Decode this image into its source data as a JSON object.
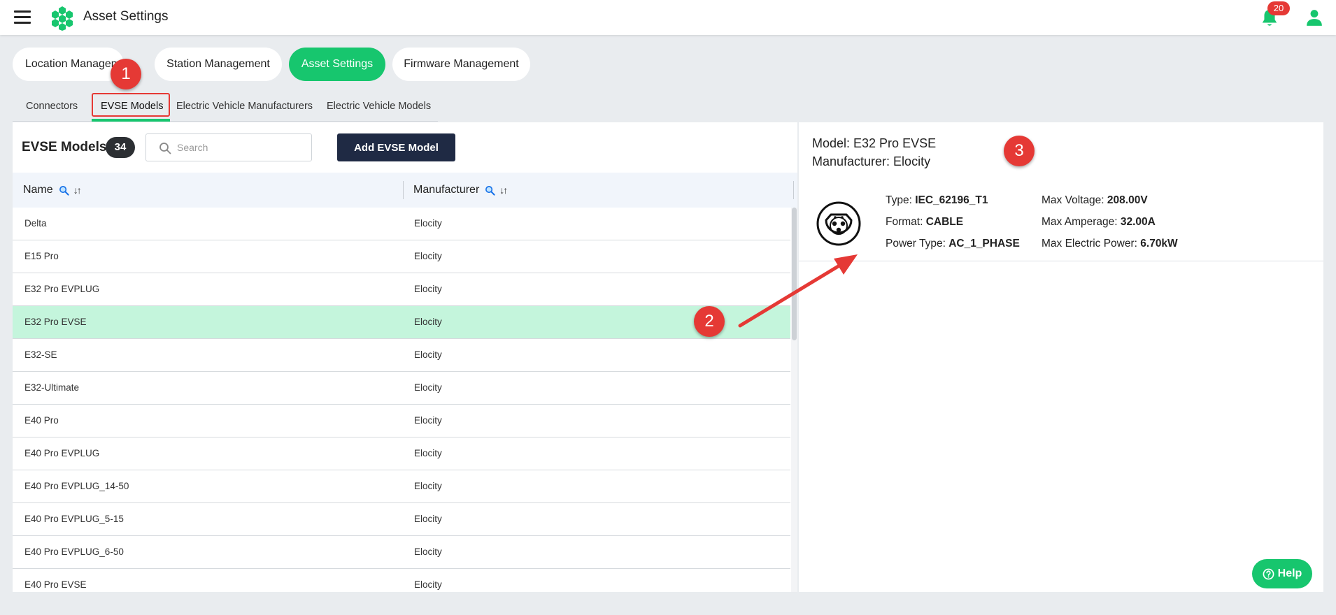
{
  "app": {
    "title": "Asset Settings"
  },
  "notifications": {
    "count": "20"
  },
  "primary_tabs": [
    {
      "label": "Location Management"
    },
    {
      "label": "Station Management"
    },
    {
      "label": "Asset Settings"
    },
    {
      "label": "Firmware Management"
    }
  ],
  "sub_tabs": [
    {
      "label": "Connectors"
    },
    {
      "label": "EVSE Models"
    },
    {
      "label": "Electric Vehicle Manufacturers"
    },
    {
      "label": "Electric Vehicle Models"
    }
  ],
  "list": {
    "title": "EVSE Models",
    "count": "34",
    "search_placeholder": "Search",
    "add_button": "Add EVSE Model",
    "columns": [
      "Name",
      "Manufacturer"
    ],
    "rows": [
      {
        "name": "Delta",
        "manufacturer": "Elocity"
      },
      {
        "name": "E15 Pro",
        "manufacturer": "Elocity"
      },
      {
        "name": "E32 Pro EVPLUG",
        "manufacturer": "Elocity"
      },
      {
        "name": "E32 Pro EVSE",
        "manufacturer": "Elocity"
      },
      {
        "name": "E32-SE",
        "manufacturer": "Elocity"
      },
      {
        "name": "E32-Ultimate",
        "manufacturer": "Elocity"
      },
      {
        "name": "E40 Pro",
        "manufacturer": "Elocity"
      },
      {
        "name": "E40 Pro EVPLUG",
        "manufacturer": "Elocity"
      },
      {
        "name": "E40 Pro EVPLUG_14-50",
        "manufacturer": "Elocity"
      },
      {
        "name": "E40 Pro EVPLUG_5-15",
        "manufacturer": "Elocity"
      },
      {
        "name": "E40 Pro EVPLUG_6-50",
        "manufacturer": "Elocity"
      },
      {
        "name": "E40 Pro EVSE",
        "manufacturer": "Elocity"
      }
    ]
  },
  "detail": {
    "model_label": "Model: E32 Pro EVSE",
    "manufacturer_label": "Manufacturer: Elocity",
    "type_key": "Type: ",
    "type_val": "IEC_62196_T1",
    "format_key": "Format: ",
    "format_val": "CABLE",
    "power_type_key": "Power Type: ",
    "power_type_val": "AC_1_PHASE",
    "max_voltage_key": "Max Voltage: ",
    "max_voltage_val": "208.00V",
    "max_amperage_key": "Max Amperage: ",
    "max_amperage_val": "32.00A",
    "max_power_key": "Max Electric Power: ",
    "max_power_val": "6.70kW"
  },
  "help": {
    "label": "Help"
  },
  "annotations": {
    "m1": "1",
    "m2": "2",
    "m3": "3"
  },
  "colors": {
    "accent": "#17c66e",
    "selected_row": "#c4f5dc",
    "dark_button": "#1f2a44",
    "annotation": "#e53935"
  }
}
